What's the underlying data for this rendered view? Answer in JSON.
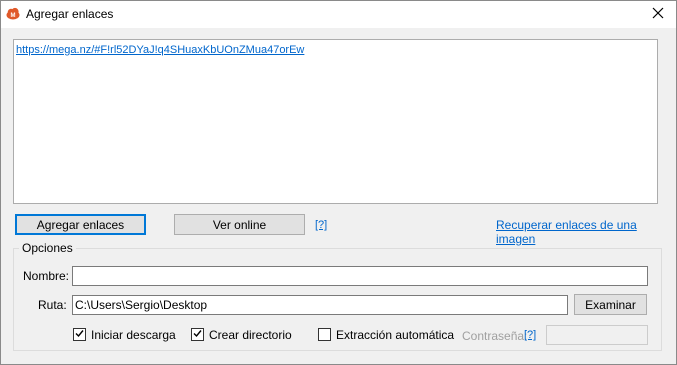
{
  "window": {
    "title": "Agregar enlaces",
    "app_icon": "mega-cloud-icon",
    "close_icon": "close-icon"
  },
  "links_area": {
    "content": "https://mega.nz/#F!rl52DYaJ!q4SHuaxKbUOnZMua47orEw"
  },
  "actions": {
    "add_links": "Agregar enlaces",
    "view_online": "Ver online",
    "help": "[?]",
    "recover_links": "Recuperar enlaces de una imagen"
  },
  "options": {
    "group_title": "Opciones",
    "name_label": "Nombre:",
    "name_value": "",
    "path_label": "Ruta:",
    "path_value": "C:\\Users\\Sergio\\Desktop",
    "browse": "Examinar",
    "start_download": {
      "label": "Iniciar descarga",
      "checked": true
    },
    "create_directory": {
      "label": "Crear directorio",
      "checked": true
    },
    "auto_extract": {
      "label": "Extracción automática",
      "checked": false
    },
    "password_label": "Contraseña:",
    "password_help": "[?]",
    "password_value": ""
  },
  "colors": {
    "link": "#0066cc",
    "accent": "#0078d7",
    "brand": "#d9534f"
  }
}
